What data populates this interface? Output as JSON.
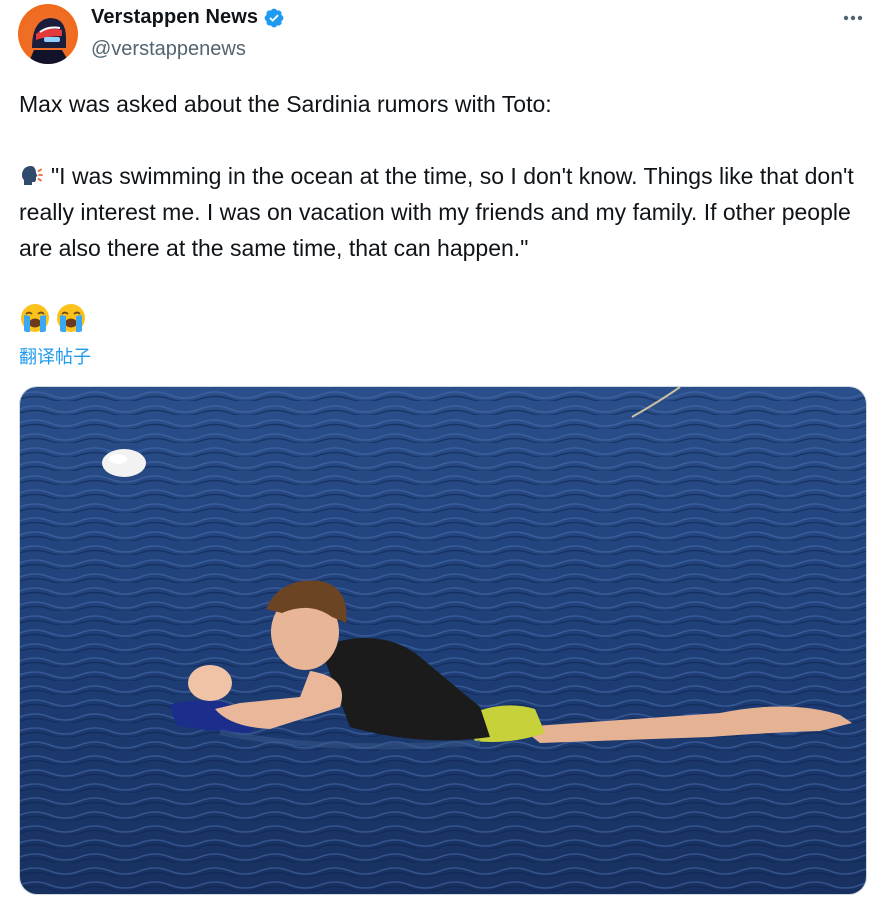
{
  "author": {
    "display_name": "Verstappen News",
    "handle": "@verstappenews",
    "verified": true,
    "avatar_icon": "racing-helmet-avatar"
  },
  "more_icon": "more-horizontal-icon",
  "post": {
    "line1": "Max was asked about the Sardinia rumors with Toto:",
    "quote_icon": "speaking-head-emoji",
    "quote": "\"I was swimming in the ocean at the time, so I don't know. Things like that don't really interest me. I was on vacation with my friends and my family. If other people are also there at the same time, that can happen.\"",
    "reaction_emojis": [
      "loudly-crying-face-emoji",
      "loudly-crying-face-emoji"
    ]
  },
  "translate_label": "翻译帖子",
  "media": {
    "type": "photo",
    "subject": "man lying on a bodyboard in the sea"
  },
  "colors": {
    "accent": "#1d9bf0",
    "text": "#0f1419",
    "secondary": "#536471",
    "sea": "#1f3f78"
  }
}
